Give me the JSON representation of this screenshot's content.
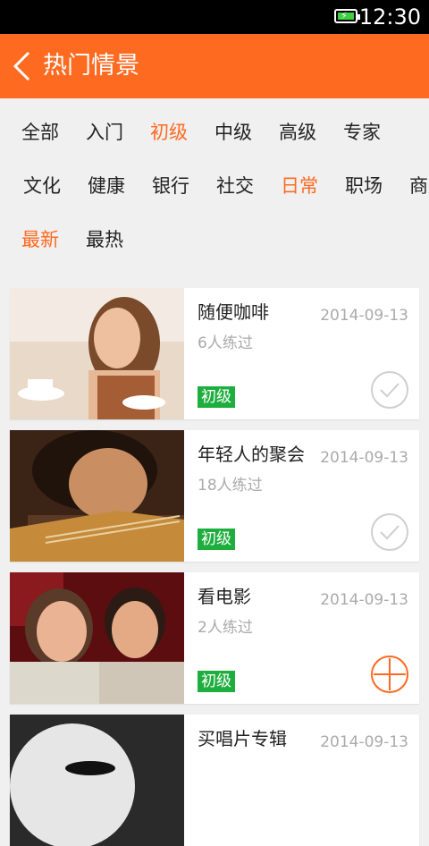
{
  "status_bar": {
    "time": "12:30"
  },
  "header": {
    "title": "热门情景",
    "back_icon": "chevron-left-icon"
  },
  "filters": {
    "level": [
      "全部",
      "入门",
      "初级",
      "中级",
      "高级",
      "专家"
    ],
    "level_selected": "初级",
    "category": [
      "文化",
      "健康",
      "银行",
      "社交",
      "日常",
      "职场",
      "商"
    ],
    "category_selected": "日常",
    "sort": [
      "最新",
      "最热"
    ],
    "sort_selected": "最新"
  },
  "scenes": [
    {
      "title": "随便咖啡",
      "date": "2014-09-13",
      "count": "6人练过",
      "level": "初级",
      "status": "done",
      "status_icon": "check-circle-icon"
    },
    {
      "title": "年轻人的聚会",
      "date": "2014-09-13",
      "count": "18人练过",
      "level": "初级",
      "status": "done",
      "status_icon": "check-circle-icon"
    },
    {
      "title": "看电影",
      "date": "2014-09-13",
      "count": "2人练过",
      "level": "初级",
      "status": "add",
      "status_icon": "plus-circle-icon"
    },
    {
      "title": "买唱片专辑",
      "date": "2014-09-13"
    }
  ],
  "colors": {
    "accent": "#ff6a21",
    "badge": "#1eae3e",
    "muted": "#aaaaaa"
  }
}
